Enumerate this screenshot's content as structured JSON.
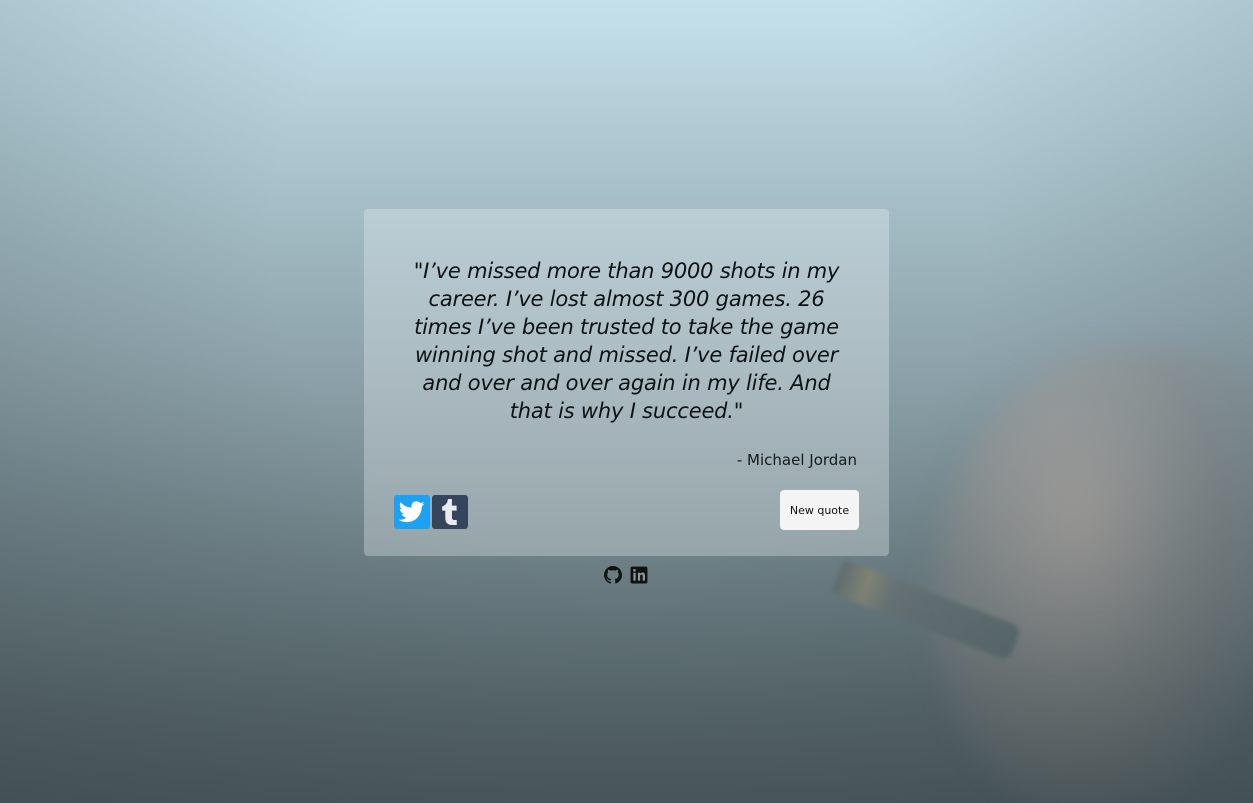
{
  "quote": {
    "text": "\"I’ve missed more than 9000 shots in my career. I’ve lost almost 300 games. 26 times I’ve been trusted to take the game winning shot and missed. I’ve failed over and over and over again in my life. And that is why I succeed.\"",
    "author": "- Michael Jordan"
  },
  "share": {
    "twitter_icon": "twitter-icon",
    "tumblr_icon": "tumblr-icon"
  },
  "actions": {
    "new_quote_label": "New quote"
  },
  "footer": {
    "github_icon": "github-icon",
    "linkedin_icon": "linkedin-icon"
  },
  "colors": {
    "twitter": "#1da1f2",
    "tumblr": "#35465c",
    "button_bg": "#f4f4f4"
  }
}
